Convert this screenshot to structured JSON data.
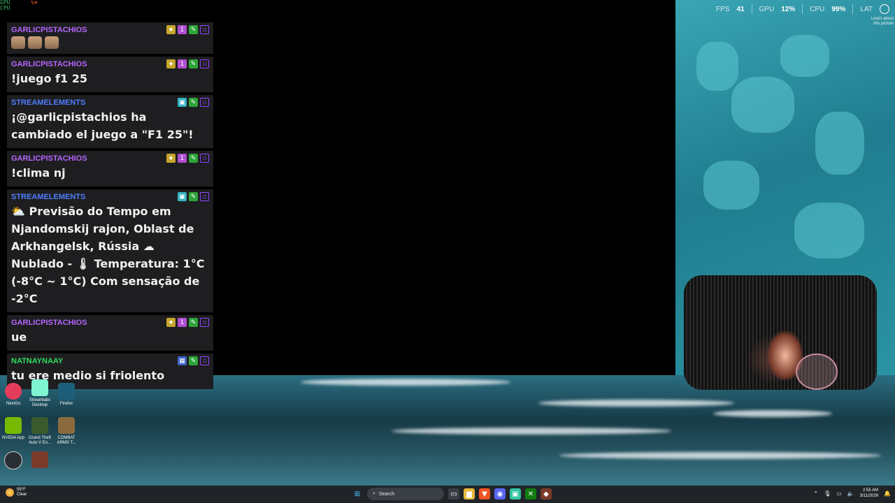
{
  "overlay": {
    "corner_left": [
      "GPU",
      "CPU"
    ],
    "corner_right": "⅙≡",
    "hud": {
      "fps_label": "FPS",
      "fps_value": "41",
      "gpu_label": "GPU",
      "gpu_value": "12%",
      "cpu_label": "CPU",
      "cpu_value": "99%",
      "lat_label": "LAT"
    },
    "learn_text": [
      "Learn about",
      "this picture"
    ]
  },
  "chat": {
    "messages": [
      {
        "user": "GARLICPISTACHIOS",
        "color": "#b565ff",
        "text": "",
        "emotes": 3,
        "badges": [
          "car-icon",
          "sub-badge-icon",
          "moderator-icon",
          "twitch-icon"
        ]
      },
      {
        "user": "GARLICPISTACHIOS",
        "color": "#b565ff",
        "text": "!juego f1 25",
        "badges": [
          "car-icon",
          "sub-badge-icon",
          "moderator-icon",
          "twitch-icon"
        ]
      },
      {
        "user": "STREAMELEMENTS",
        "color": "#4f7dff",
        "text": "¡@garlicpistachios ha cambiado el juego a \"F1 25\"!",
        "badges": [
          "bot-icon",
          "moderator-icon",
          "twitch-icon"
        ]
      },
      {
        "user": "GARLICPISTACHIOS",
        "color": "#b565ff",
        "text": "!clima nj",
        "badges": [
          "car-icon",
          "sub-badge-icon",
          "moderator-icon",
          "twitch-icon"
        ]
      },
      {
        "user": "STREAMELEMENTS",
        "color": "#4f7dff",
        "text": "⛅ Previsão do Tempo em Njandomskij rajon, Oblast de Arkhangelsk, Rússia ☁ Nublado - 🌡 Temperatura: 1°C (-8°C ~ 1°C) Com sensação de -2°C",
        "badges": [
          "bot-icon",
          "moderator-icon",
          "twitch-icon"
        ]
      },
      {
        "user": "GARLICPISTACHIOS",
        "color": "#b565ff",
        "text": "ue",
        "badges": [
          "car-icon",
          "sub-badge-icon",
          "moderator-icon",
          "twitch-icon"
        ]
      },
      {
        "user": "NATNAYNAAY",
        "color": "#2ee05f",
        "text": "tu ere medio si friolento",
        "badges": [
          "gift-icon",
          "moderator-icon",
          "twitch-icon"
        ]
      }
    ]
  },
  "desktop_icons": [
    {
      "label": "NexiGo",
      "color": "#e53c5b"
    },
    {
      "label": "Streamlabs Desktop",
      "color": "#80f5d2"
    },
    {
      "label": "Firefox",
      "color": "#1d5f7a"
    },
    {
      "label": "NVIDIA App",
      "color": "#76b900"
    },
    {
      "label": "Grand Theft Auto V En...",
      "color": "#3b5b2e"
    },
    {
      "label": "COMBAT ARMS T...",
      "color": "#8b6b3e"
    },
    {
      "label": "",
      "color": "#2a2f35"
    },
    {
      "label": "",
      "color": "#7a3a2a"
    }
  ],
  "taskbar": {
    "weather_temp": "59°F",
    "weather_desc": "Clear",
    "search_placeholder": "Search",
    "clock_time": "2:55 AM",
    "clock_date": "3/11/2026"
  }
}
